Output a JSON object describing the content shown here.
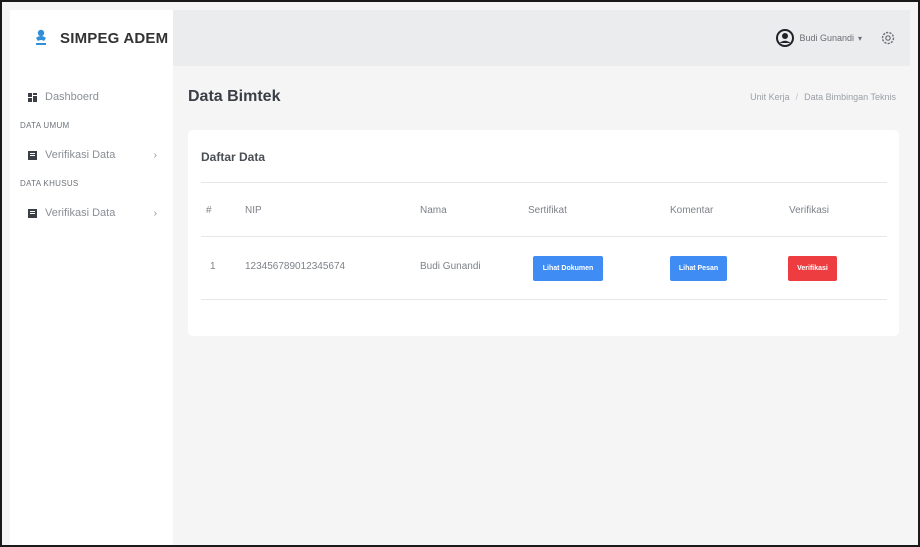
{
  "app": {
    "name": "SIMPEG ADEM"
  },
  "sidebar": {
    "dashboard": "Dashboerd",
    "section_umum": "DATA UMUM",
    "verif_umum": "Verifikasi Data",
    "section_khusus": "DATA KHUSUS",
    "verif_khusus": "Verifikasi Data"
  },
  "topbar": {
    "user_name": "Budi Gunandi"
  },
  "page": {
    "title": "Data Bimtek",
    "breadcrumb": [
      "Unit Kerja",
      "Data Bimbingan Teknis"
    ]
  },
  "card": {
    "title": "Daftar Data"
  },
  "table": {
    "headers": [
      "#",
      "NIP",
      "Nama",
      "Sertifikat",
      "Komentar",
      "Verifikasi"
    ],
    "rows": [
      {
        "no": "1",
        "nip": "123456789012345674",
        "nama": "Budi Gunandi",
        "sertifikat_btn": "Lihat Dokumen",
        "komentar_btn": "Lihat Pesan",
        "verifikasi_btn": "Verifikasi"
      }
    ]
  },
  "colors": {
    "primary": "#3f8cf4",
    "danger": "#ee3d40",
    "topbar": "#ebecee"
  },
  "icons": [
    "logo-icon",
    "dashboard-icon",
    "data-icon",
    "chevron-right-icon",
    "user-avatar-icon",
    "caret-down-icon",
    "gear-icon"
  ]
}
